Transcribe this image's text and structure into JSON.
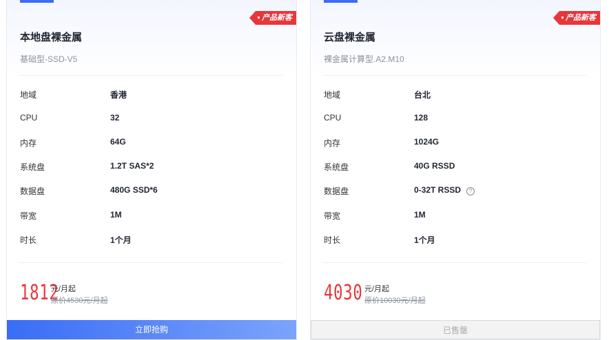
{
  "cards": [
    {
      "badge": "产品新客",
      "title": "本地盘裸金属",
      "subtitle": "基础型-SSD-V5",
      "specs": [
        {
          "label": "地域",
          "value": "香港"
        },
        {
          "label": "CPU",
          "value": "32"
        },
        {
          "label": "内存",
          "value": "64G"
        },
        {
          "label": "系统盘",
          "value": "1.2T SAS*2"
        },
        {
          "label": "数据盘",
          "value": "480G SSD*6"
        },
        {
          "label": "带宽",
          "value": "1M"
        },
        {
          "label": "时长",
          "value": "1个月"
        }
      ],
      "price": "1812",
      "price_unit": "元/月起",
      "original_price": "原价4530元/月起",
      "button": "立即抢购",
      "button_state": "primary"
    },
    {
      "badge": "产品新客",
      "title": "云盘裸金属",
      "subtitle": "裸金属计算型.A2.M10",
      "specs": [
        {
          "label": "地域",
          "value": "台北"
        },
        {
          "label": "CPU",
          "value": "128"
        },
        {
          "label": "内存",
          "value": "1024G"
        },
        {
          "label": "系统盘",
          "value": "40G RSSD"
        },
        {
          "label": "数据盘",
          "value": "0-32T RSSD",
          "help_icon": "question-circle-icon"
        },
        {
          "label": "带宽",
          "value": "1M"
        },
        {
          "label": "时长",
          "value": "1个月"
        }
      ],
      "price": "4030",
      "price_unit": "元/月起",
      "original_price": "原价10030元/月起",
      "button": "已售罄",
      "button_state": "disabled"
    }
  ],
  "colors": {
    "accent": "#3a6cf6",
    "badge": "#e8363a",
    "price": "#e8363a"
  }
}
